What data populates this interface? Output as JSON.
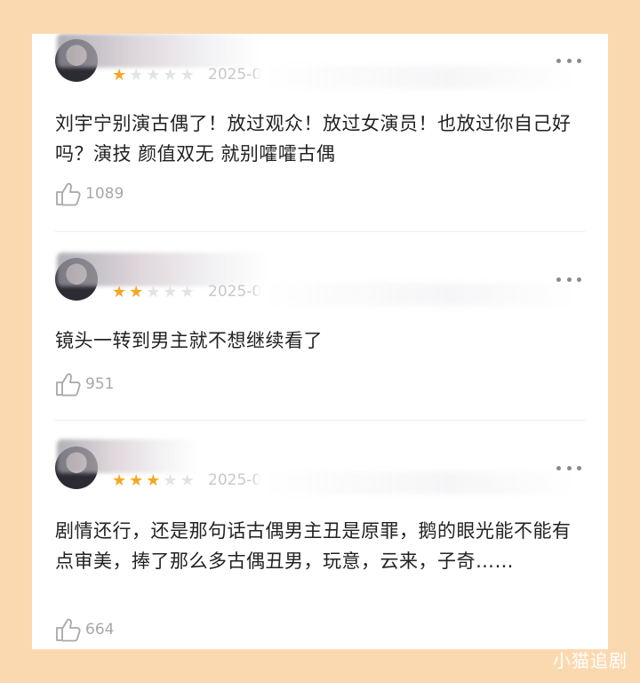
{
  "reviews": [
    {
      "rating": 1,
      "date": "2025-0",
      "text": "刘宇宁别演古偶了！放过观众！放过女演员！也放过你自己好吗？演技 颜值双无 就别嚯嚯古偶",
      "likes": "1089"
    },
    {
      "rating": 2,
      "date": "2025-0",
      "text": "镜头一转到男主就不想继续看了",
      "likes": "951"
    },
    {
      "rating": 3,
      "date": "2025-0",
      "text": "剧情还行，还是那句话古偶男主丑是原罪，鹅的眼光能不能有点审美，捧了那么多古偶丑男，玩意，云来，子奇……",
      "likes": "664"
    }
  ],
  "icons": {
    "like": "thumbs-up-icon",
    "more": "more-options-icon",
    "star": "star-icon"
  },
  "colors": {
    "background": "#FBD9B0",
    "star_active": "#F5A623",
    "star_inactive": "#E3E3E3"
  },
  "watermark": "小猫追剧"
}
